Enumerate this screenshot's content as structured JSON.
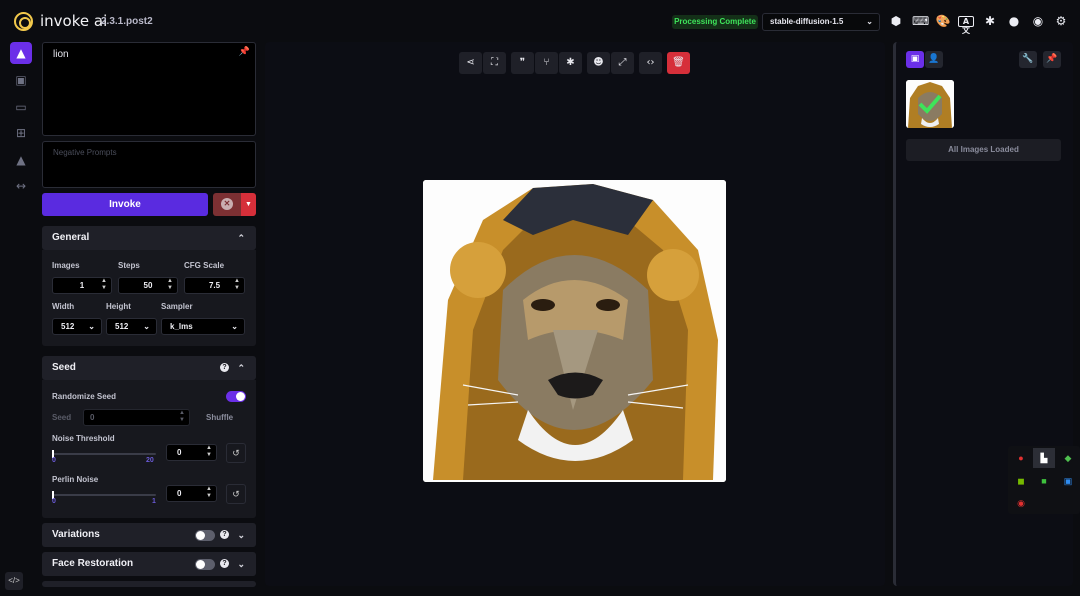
{
  "header": {
    "app_name": "invoke ai",
    "version": "2.3.1.post2",
    "status": "Processing Complete",
    "model": "stable-diffusion-1.5"
  },
  "prompt": {
    "positive": "lion",
    "negative_placeholder": "Negative Prompts"
  },
  "actions": {
    "invoke_label": "Invoke"
  },
  "general": {
    "title": "General",
    "images_label": "Images",
    "images_value": "1",
    "steps_label": "Steps",
    "steps_value": "50",
    "cfg_label": "CFG Scale",
    "cfg_value": "7.5",
    "width_label": "Width",
    "width_value": "512",
    "height_label": "Height",
    "height_value": "512",
    "sampler_label": "Sampler",
    "sampler_value": "k_lms"
  },
  "seed": {
    "title": "Seed",
    "randomize_label": "Randomize Seed",
    "randomize_on": true,
    "seed_label": "Seed",
    "seed_value": "0",
    "shuffle_label": "Shuffle",
    "noise_label": "Noise Threshold",
    "noise_min": "0",
    "noise_max": "20",
    "noise_value": "0",
    "perlin_label": "Perlin Noise",
    "perlin_min": "0",
    "perlin_max": "1",
    "perlin_value": "0"
  },
  "variations": {
    "title": "Variations",
    "enabled": false
  },
  "face_restoration": {
    "title": "Face Restoration",
    "enabled": false
  },
  "gallery": {
    "status_text": "All Images Loaded"
  },
  "colors": {
    "accent": "#6b2fe8",
    "invoke": "#5a2be0",
    "status_green": "#3ee35a",
    "danger": "#d62f3a"
  }
}
